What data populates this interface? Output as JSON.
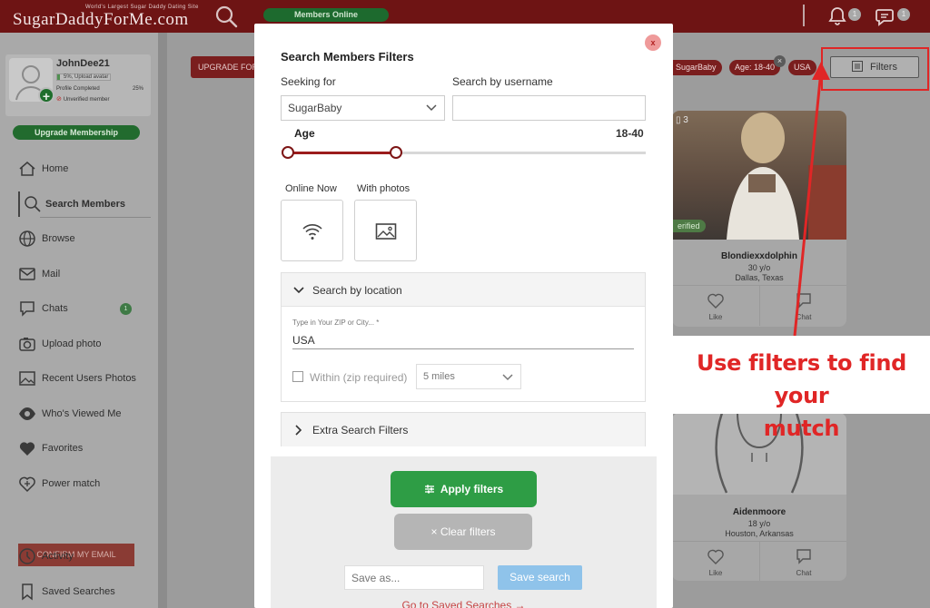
{
  "header": {
    "logo_text": "SugarDaddyForMe.com",
    "logo_tagline": "World's Largest Sugar Daddy Dating Site",
    "members_online": "Members Online",
    "notifications_count": "1",
    "messages_count": "1"
  },
  "sidebar": {
    "username": "JohnDee21",
    "progress_text": "5%, Upload avatar",
    "progress_percent": 5,
    "profile_completed_label": "Profile Completed",
    "profile_completed_value": "25%",
    "unverified": "Unverified member",
    "upgrade_label": "Upgrade Membership",
    "items": [
      {
        "label": "Home",
        "icon": "home-icon"
      },
      {
        "label": "Search Members",
        "icon": "search-icon",
        "active": true
      },
      {
        "label": "Browse",
        "icon": "globe-icon"
      },
      {
        "label": "Mail",
        "icon": "mail-icon"
      },
      {
        "label": "Chats",
        "icon": "chat-icon",
        "count": "1"
      },
      {
        "label": "Upload photo",
        "icon": "camera-icon"
      },
      {
        "label": "Recent Users Photos",
        "icon": "image-icon"
      },
      {
        "label": "Who's Viewed Me",
        "icon": "eye-icon"
      },
      {
        "label": "Favorites",
        "icon": "heart-icon"
      },
      {
        "label": "Power match",
        "icon": "power-match-icon"
      }
    ],
    "confirm_email": "CONFIRM MY EMAIL",
    "items_after": [
      {
        "label": "Activity",
        "icon": "clock-icon"
      },
      {
        "label": "Saved Searches",
        "icon": "bookmark-icon"
      }
    ]
  },
  "background": {
    "upgrade_banner": "UPGRADE FOR",
    "chips": [
      ": SugarBaby",
      "Age: 18-40",
      "USA"
    ],
    "filters_button": "Filters",
    "cards": [
      {
        "photo_count": "3",
        "verified": "erified",
        "name": "Blondiexxdolphin",
        "age": "30 y/o",
        "location": "Dallas, Texas",
        "like": "Like",
        "chat": "Chat"
      },
      {
        "name": "Aidenmoore",
        "age": "18 y/o",
        "location": "Houston, Arkansas",
        "like": "Like",
        "chat": "Chat"
      }
    ]
  },
  "annotation": {
    "line1": "Use filters to find your",
    "line2": "mutch",
    "color": "#e02626"
  },
  "modal": {
    "close_label": "x",
    "title": "Search Members Filters",
    "seeking_label": "Seeking for",
    "seeking_value": "SugarBaby",
    "username_label": "Search by username",
    "username_value": "",
    "age_label": "Age",
    "age_range": "18-40",
    "online_now_label": "Online Now",
    "with_photos_label": "With photos",
    "location_heading": "Search by location",
    "zip_label": "Type in Your ZIP or City... *",
    "zip_value": "USA",
    "within_label": "Within (zip required)",
    "miles_value": "5 miles",
    "extra_heading": "Extra Search Filters",
    "apply_label": "Apply filters",
    "clear_label": "× Clear filters",
    "save_placeholder": "Save as...",
    "save_button": "Save search",
    "saved_link": "Go to Saved Searches →",
    "accent_color": "#2e9d45"
  }
}
